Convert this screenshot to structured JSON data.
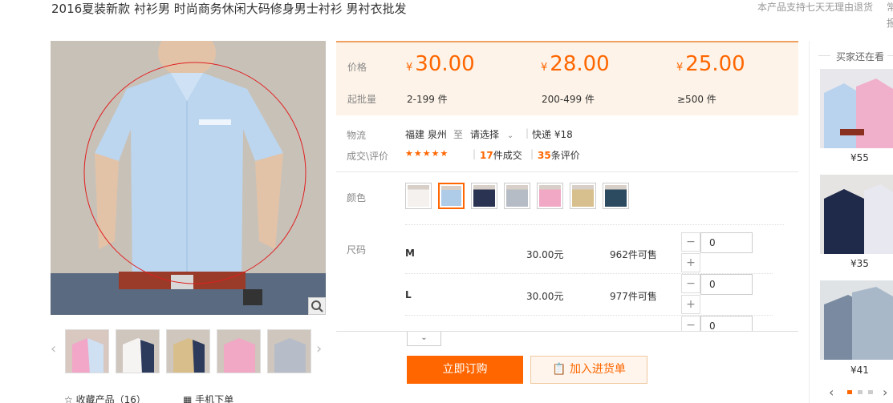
{
  "product": {
    "title": "2016夏装新款 衬衫男 时尚商务休闲大码修身男士衬衫 男衬衣批发",
    "return_note": "本产品支持七天无理由退货",
    "clip_text_1": "常",
    "clip_text_2": "报"
  },
  "pricing": {
    "price_label": "价格",
    "moq_label": "起批量",
    "currency": "¥",
    "tiers": [
      {
        "price": "30.00",
        "qty": "2-199 件"
      },
      {
        "price": "28.00",
        "qty": "200-499 件"
      },
      {
        "price": "25.00",
        "qty": "≥500 件"
      }
    ]
  },
  "logistics": {
    "label": "物流",
    "origin": "福建 泉州",
    "to": "至",
    "destination": "请选择",
    "express": "快递 ¥18"
  },
  "trade": {
    "label": "成交\\评价",
    "stars": "★★★★★",
    "deals_num": "17",
    "deals_text": "件成交",
    "reviews_num": "35",
    "reviews_text": "条评价"
  },
  "color": {
    "label": "颜色",
    "swatches": [
      "#f4f1ee",
      "#aecbe8",
      "#2a3452",
      "#b6bcc6",
      "#f0a8c4",
      "#d8bf8e",
      "#2c4a60"
    ],
    "selected_index": 1
  },
  "size": {
    "label": "尺码",
    "rows": [
      {
        "name": "M",
        "price": "30.00元",
        "stock": "962件可售",
        "qty": "0"
      },
      {
        "name": "L",
        "price": "30.00元",
        "stock": "977件可售",
        "qty": "0"
      },
      {
        "name": "",
        "price": "",
        "stock": "",
        "qty": "0"
      }
    ],
    "minus": "−",
    "plus": "+"
  },
  "actions": {
    "more": "⌄",
    "buy": "立即订购",
    "cart": "加入进货单"
  },
  "gallery": {
    "favorite": "收藏产品（16）",
    "mobile_order": "手机下单",
    "prev": "‹",
    "next": "›"
  },
  "rail": {
    "title": "买家还在看",
    "items": [
      {
        "price": "¥55"
      },
      {
        "price": "¥35"
      },
      {
        "price": "¥41"
      }
    ],
    "prev": "‹",
    "next": "›"
  }
}
